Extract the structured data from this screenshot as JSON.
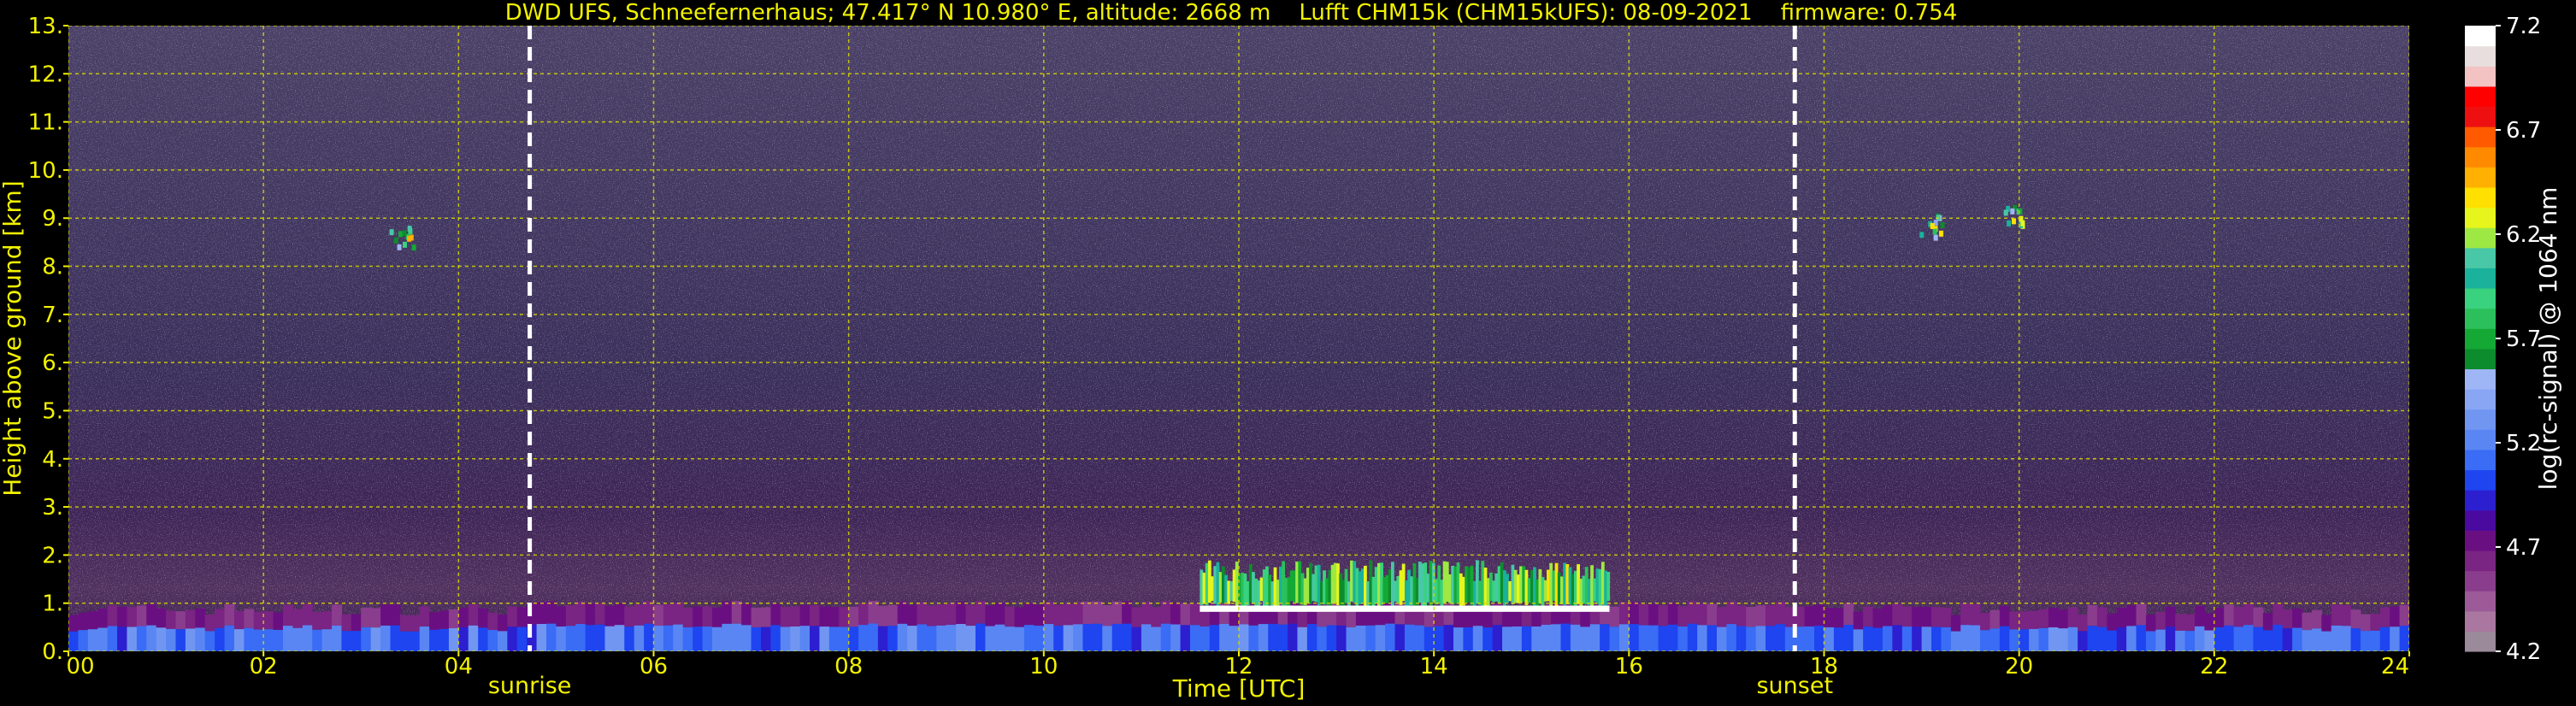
{
  "chart_data": {
    "type": "heatmap",
    "title_parts": [
      "DWD UFS, Schneefernerhaus; 47.417° N 10.980° E, altitude: 2668 m",
      "Lufft CHM15k (CHM15kUFS): 08-09-2021",
      "firmware: 0.754"
    ],
    "xlabel": "Time [UTC]",
    "ylabel": "Height above ground [km]",
    "xlim": [
      0,
      24
    ],
    "ylim": [
      0,
      13
    ],
    "x_ticks": [
      0,
      2,
      4,
      6,
      8,
      10,
      12,
      14,
      16,
      18,
      20,
      22,
      24
    ],
    "x_tick_labels": [
      "00",
      "02",
      "04",
      "06",
      "08",
      "10",
      "12",
      "14",
      "16",
      "18",
      "20",
      "22",
      "24"
    ],
    "y_ticks": [
      0,
      1,
      2,
      3,
      4,
      5,
      6,
      7,
      8,
      9,
      10,
      11,
      12,
      13
    ],
    "y_tick_labels": [
      "0.",
      "1.",
      "2.",
      "3.",
      "4.",
      "5.",
      "6.",
      "7.",
      "8.",
      "9.",
      "10.",
      "11.",
      "12.",
      "13."
    ],
    "grid": true,
    "colorbar": {
      "label": "log(rc-signal) @ 1064 nm",
      "range": [
        4.2,
        7.2
      ],
      "tick_values": [
        4.2,
        4.7,
        5.2,
        5.7,
        6.2,
        6.7,
        7.2
      ],
      "tick_labels": [
        "4.2",
        "4.7",
        "5.2",
        "5.7",
        "6.2",
        "6.7",
        "7.2"
      ],
      "colors": [
        "#9a8a9a",
        "#a9779f",
        "#9c5b98",
        "#8a3d8d",
        "#7a2483",
        "#6a0f82",
        "#4a0aa0",
        "#2c1fd0",
        "#1e45f0",
        "#3a6cf5",
        "#5a86f3",
        "#7196f2",
        "#88a6f4",
        "#9fb6f6",
        "#0c8c2c",
        "#14a834",
        "#2cc05c",
        "#39d27e",
        "#1ab29a",
        "#48c8a6",
        "#9ee844",
        "#e6f51c",
        "#ffe000",
        "#ffb000",
        "#ff8a00",
        "#ff5a00",
        "#ee1010",
        "#ff0000",
        "#f3c2c2",
        "#e8dede",
        "#ffffff"
      ]
    },
    "events": [
      {
        "label": "sunrise",
        "time": 4.73
      },
      {
        "label": "sunset",
        "time": 17.7
      }
    ],
    "layers": [
      {
        "name": "boundary layer",
        "t_start": 0,
        "t_end": 24,
        "height_top": 1.0
      },
      {
        "name": "cloud band",
        "t_start": 11.6,
        "t_end": 15.8,
        "height_base": 0.9,
        "height_top": 1.9
      },
      {
        "name": "high cloud patch",
        "time": 3.4,
        "height": 8.6
      },
      {
        "name": "high cloud patch",
        "time": 19.1,
        "height": 8.9
      },
      {
        "name": "high cloud patch",
        "time": 19.9,
        "height": 9.1
      }
    ]
  }
}
